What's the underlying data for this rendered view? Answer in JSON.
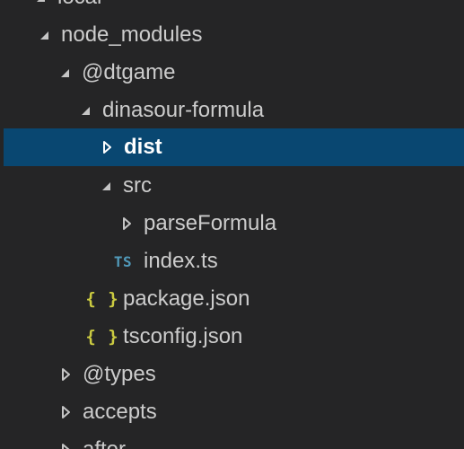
{
  "explorer": {
    "items": [
      {
        "label": "local",
        "type": "folder",
        "expanded": true
      },
      {
        "label": "node_modules",
        "type": "folder",
        "expanded": true
      },
      {
        "label": "@dtgame",
        "type": "folder",
        "expanded": true
      },
      {
        "label": "dinasour-formula",
        "type": "folder",
        "expanded": true
      },
      {
        "label": "dist",
        "type": "folder",
        "expanded": false,
        "selected": true
      },
      {
        "label": "src",
        "type": "folder",
        "expanded": true
      },
      {
        "label": "parseFormula",
        "type": "folder",
        "expanded": false
      },
      {
        "label": "index.ts",
        "type": "file",
        "icon": "typescript-icon",
        "icon_text": "TS"
      },
      {
        "label": "package.json",
        "type": "file",
        "icon": "json-icon",
        "icon_text": "{ }"
      },
      {
        "label": "tsconfig.json",
        "type": "file",
        "icon": "json-icon",
        "icon_text": "{ }"
      },
      {
        "label": "@types",
        "type": "folder",
        "expanded": false
      },
      {
        "label": "accepts",
        "type": "folder",
        "expanded": false
      },
      {
        "label": "after",
        "type": "folder",
        "expanded": false
      }
    ]
  },
  "colors": {
    "background": "#252526",
    "selection": "#094771",
    "text": "#cccccc",
    "selected_text": "#ffffff",
    "ts_icon": "#519aba",
    "json_icon": "#cbcb41"
  }
}
